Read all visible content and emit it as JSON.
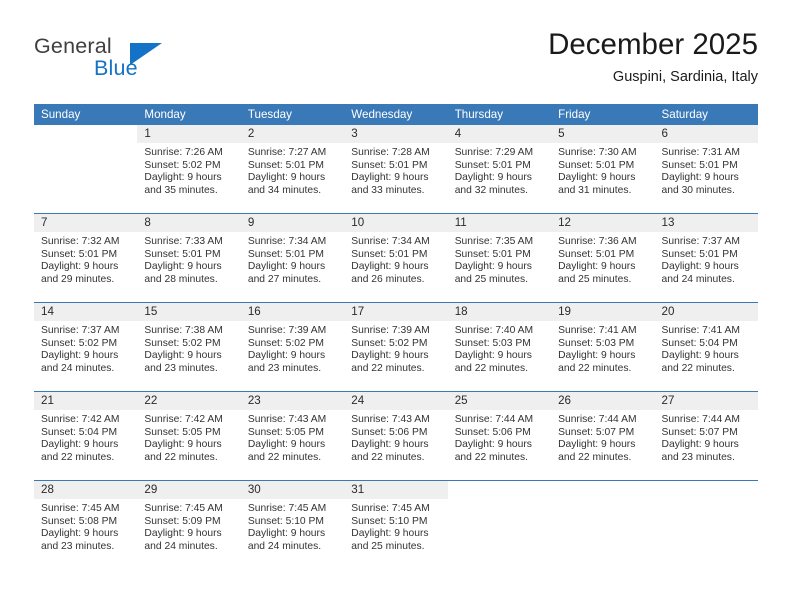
{
  "logo": {
    "word1": "General",
    "word2": "Blue",
    "triangle_icon": "triangle-icon",
    "color_text": "#3f3f3f",
    "color_blue": "#1473c6"
  },
  "header": {
    "title": "December 2025",
    "subtitle": "Guspini, Sardinia, Italy"
  },
  "theme": {
    "header_bg": "#3a79b8",
    "header_text": "#ffffff",
    "daynum_bg": "#efefef",
    "cell_bg": "#ffffff",
    "text": "#333333"
  },
  "weekdays": [
    "Sunday",
    "Monday",
    "Tuesday",
    "Wednesday",
    "Thursday",
    "Friday",
    "Saturday"
  ],
  "weeks": [
    [
      {
        "day": "",
        "lines": []
      },
      {
        "day": "1",
        "lines": [
          "Sunrise: 7:26 AM",
          "Sunset: 5:02 PM",
          "Daylight: 9 hours",
          "and 35 minutes."
        ]
      },
      {
        "day": "2",
        "lines": [
          "Sunrise: 7:27 AM",
          "Sunset: 5:01 PM",
          "Daylight: 9 hours",
          "and 34 minutes."
        ]
      },
      {
        "day": "3",
        "lines": [
          "Sunrise: 7:28 AM",
          "Sunset: 5:01 PM",
          "Daylight: 9 hours",
          "and 33 minutes."
        ]
      },
      {
        "day": "4",
        "lines": [
          "Sunrise: 7:29 AM",
          "Sunset: 5:01 PM",
          "Daylight: 9 hours",
          "and 32 minutes."
        ]
      },
      {
        "day": "5",
        "lines": [
          "Sunrise: 7:30 AM",
          "Sunset: 5:01 PM",
          "Daylight: 9 hours",
          "and 31 minutes."
        ]
      },
      {
        "day": "6",
        "lines": [
          "Sunrise: 7:31 AM",
          "Sunset: 5:01 PM",
          "Daylight: 9 hours",
          "and 30 minutes."
        ]
      }
    ],
    [
      {
        "day": "7",
        "lines": [
          "Sunrise: 7:32 AM",
          "Sunset: 5:01 PM",
          "Daylight: 9 hours",
          "and 29 minutes."
        ]
      },
      {
        "day": "8",
        "lines": [
          "Sunrise: 7:33 AM",
          "Sunset: 5:01 PM",
          "Daylight: 9 hours",
          "and 28 minutes."
        ]
      },
      {
        "day": "9",
        "lines": [
          "Sunrise: 7:34 AM",
          "Sunset: 5:01 PM",
          "Daylight: 9 hours",
          "and 27 minutes."
        ]
      },
      {
        "day": "10",
        "lines": [
          "Sunrise: 7:34 AM",
          "Sunset: 5:01 PM",
          "Daylight: 9 hours",
          "and 26 minutes."
        ]
      },
      {
        "day": "11",
        "lines": [
          "Sunrise: 7:35 AM",
          "Sunset: 5:01 PM",
          "Daylight: 9 hours",
          "and 25 minutes."
        ]
      },
      {
        "day": "12",
        "lines": [
          "Sunrise: 7:36 AM",
          "Sunset: 5:01 PM",
          "Daylight: 9 hours",
          "and 25 minutes."
        ]
      },
      {
        "day": "13",
        "lines": [
          "Sunrise: 7:37 AM",
          "Sunset: 5:01 PM",
          "Daylight: 9 hours",
          "and 24 minutes."
        ]
      }
    ],
    [
      {
        "day": "14",
        "lines": [
          "Sunrise: 7:37 AM",
          "Sunset: 5:02 PM",
          "Daylight: 9 hours",
          "and 24 minutes."
        ]
      },
      {
        "day": "15",
        "lines": [
          "Sunrise: 7:38 AM",
          "Sunset: 5:02 PM",
          "Daylight: 9 hours",
          "and 23 minutes."
        ]
      },
      {
        "day": "16",
        "lines": [
          "Sunrise: 7:39 AM",
          "Sunset: 5:02 PM",
          "Daylight: 9 hours",
          "and 23 minutes."
        ]
      },
      {
        "day": "17",
        "lines": [
          "Sunrise: 7:39 AM",
          "Sunset: 5:02 PM",
          "Daylight: 9 hours",
          "and 22 minutes."
        ]
      },
      {
        "day": "18",
        "lines": [
          "Sunrise: 7:40 AM",
          "Sunset: 5:03 PM",
          "Daylight: 9 hours",
          "and 22 minutes."
        ]
      },
      {
        "day": "19",
        "lines": [
          "Sunrise: 7:41 AM",
          "Sunset: 5:03 PM",
          "Daylight: 9 hours",
          "and 22 minutes."
        ]
      },
      {
        "day": "20",
        "lines": [
          "Sunrise: 7:41 AM",
          "Sunset: 5:04 PM",
          "Daylight: 9 hours",
          "and 22 minutes."
        ]
      }
    ],
    [
      {
        "day": "21",
        "lines": [
          "Sunrise: 7:42 AM",
          "Sunset: 5:04 PM",
          "Daylight: 9 hours",
          "and 22 minutes."
        ]
      },
      {
        "day": "22",
        "lines": [
          "Sunrise: 7:42 AM",
          "Sunset: 5:05 PM",
          "Daylight: 9 hours",
          "and 22 minutes."
        ]
      },
      {
        "day": "23",
        "lines": [
          "Sunrise: 7:43 AM",
          "Sunset: 5:05 PM",
          "Daylight: 9 hours",
          "and 22 minutes."
        ]
      },
      {
        "day": "24",
        "lines": [
          "Sunrise: 7:43 AM",
          "Sunset: 5:06 PM",
          "Daylight: 9 hours",
          "and 22 minutes."
        ]
      },
      {
        "day": "25",
        "lines": [
          "Sunrise: 7:44 AM",
          "Sunset: 5:06 PM",
          "Daylight: 9 hours",
          "and 22 minutes."
        ]
      },
      {
        "day": "26",
        "lines": [
          "Sunrise: 7:44 AM",
          "Sunset: 5:07 PM",
          "Daylight: 9 hours",
          "and 22 minutes."
        ]
      },
      {
        "day": "27",
        "lines": [
          "Sunrise: 7:44 AM",
          "Sunset: 5:07 PM",
          "Daylight: 9 hours",
          "and 23 minutes."
        ]
      }
    ],
    [
      {
        "day": "28",
        "lines": [
          "Sunrise: 7:45 AM",
          "Sunset: 5:08 PM",
          "Daylight: 9 hours",
          "and 23 minutes."
        ]
      },
      {
        "day": "29",
        "lines": [
          "Sunrise: 7:45 AM",
          "Sunset: 5:09 PM",
          "Daylight: 9 hours",
          "and 24 minutes."
        ]
      },
      {
        "day": "30",
        "lines": [
          "Sunrise: 7:45 AM",
          "Sunset: 5:10 PM",
          "Daylight: 9 hours",
          "and 24 minutes."
        ]
      },
      {
        "day": "31",
        "lines": [
          "Sunrise: 7:45 AM",
          "Sunset: 5:10 PM",
          "Daylight: 9 hours",
          "and 25 minutes."
        ]
      },
      {
        "day": "",
        "lines": []
      },
      {
        "day": "",
        "lines": []
      },
      {
        "day": "",
        "lines": []
      }
    ]
  ]
}
